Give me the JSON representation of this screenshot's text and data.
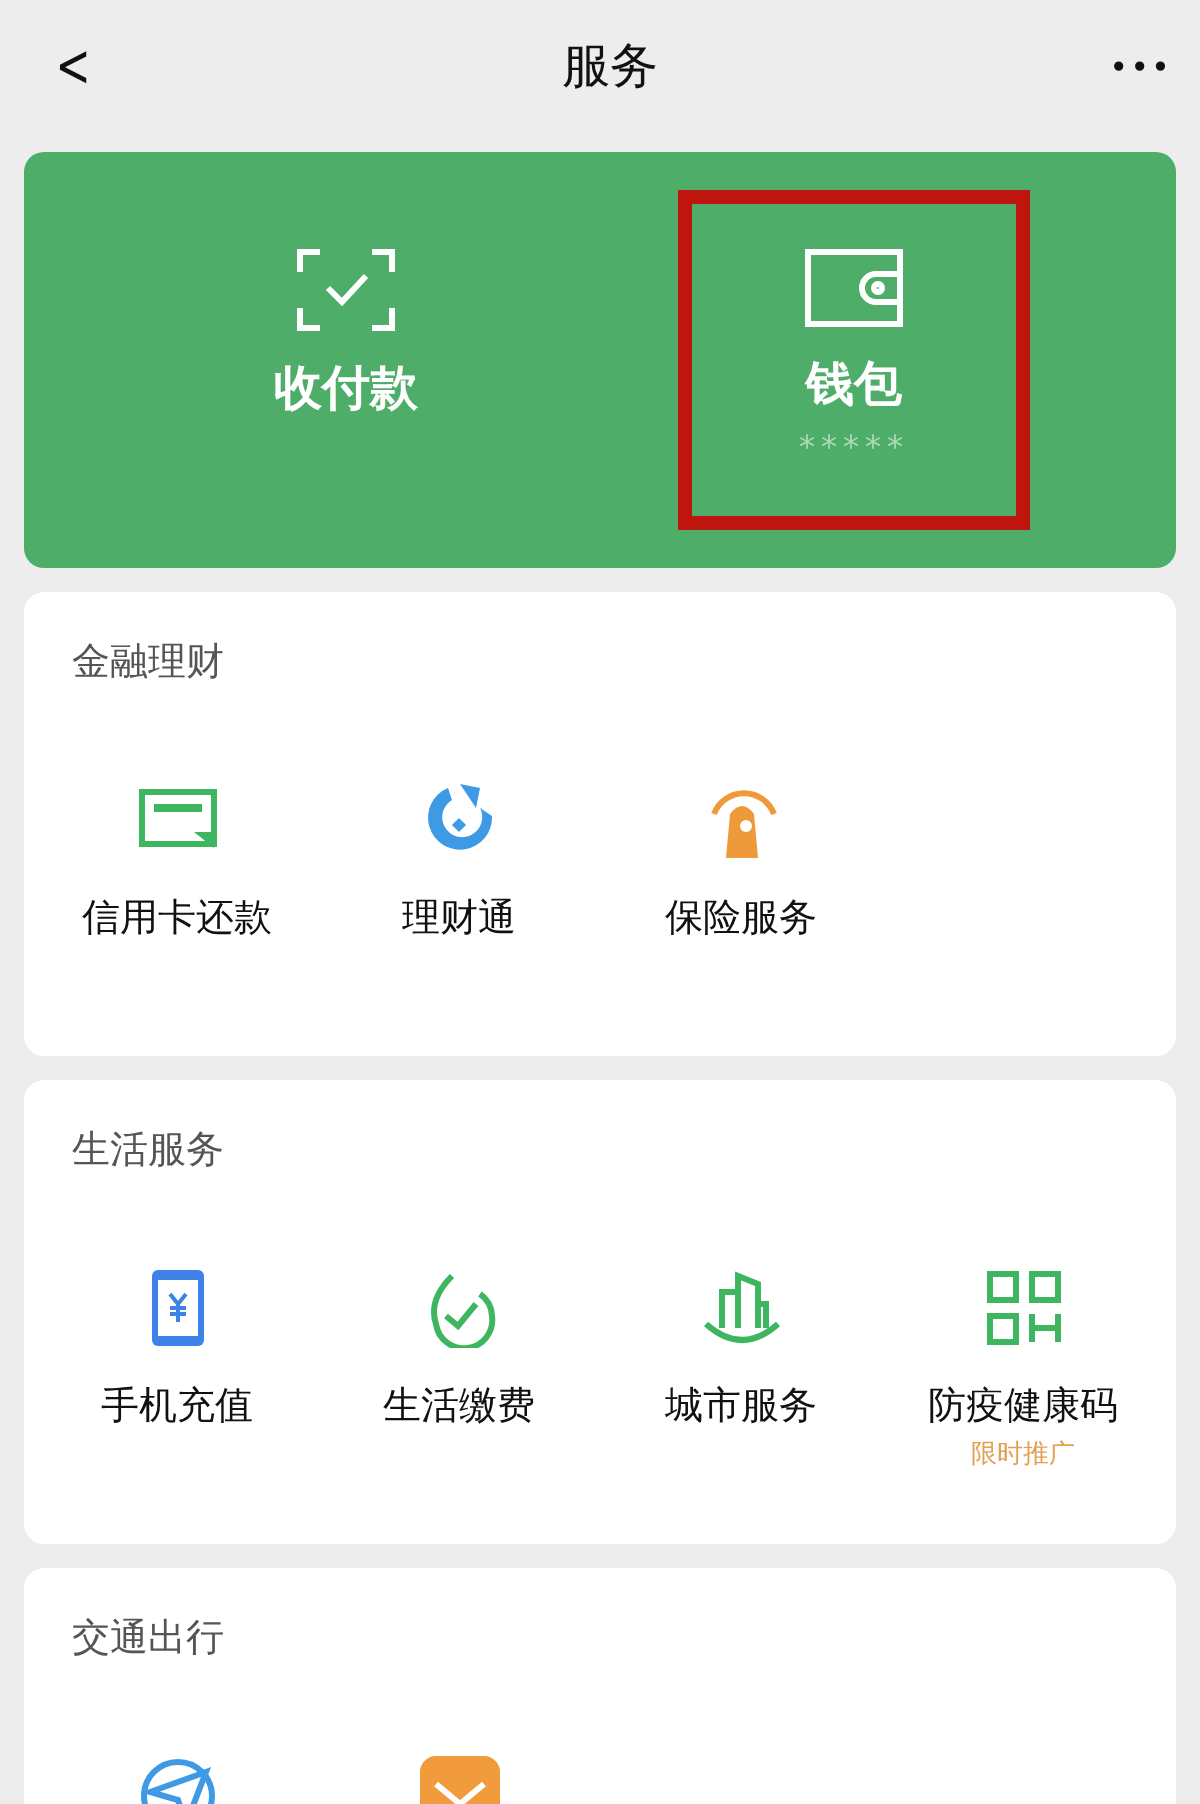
{
  "nav": {
    "back": "<",
    "title": "服务",
    "more": "•••"
  },
  "hero": [
    {
      "label": "收付款",
      "highlighted": false
    },
    {
      "label": "钱包",
      "sub": "*****",
      "highlighted": true
    }
  ],
  "sections": [
    {
      "title": "金融理财",
      "items": [
        {
          "kind": "labeled",
          "label": "信用卡还款"
        },
        {
          "kind": "labeled",
          "label": "理财通"
        },
        {
          "kind": "labeled",
          "label": "保险服务"
        }
      ]
    },
    {
      "title": "生活服务",
      "items": [
        {
          "kind": "labeled",
          "label": "手机充值"
        },
        {
          "kind": "labeled",
          "label": "生活缴费"
        },
        {
          "kind": "labeled",
          "label": "城市服务"
        },
        {
          "kind": "labeled",
          "label": "防疫健康码",
          "tag": "限时推广"
        }
      ]
    },
    {
      "title": "交通出行",
      "items": [
        {
          "kind": "icon-only"
        },
        {
          "kind": "icon-only"
        }
      ]
    }
  ]
}
